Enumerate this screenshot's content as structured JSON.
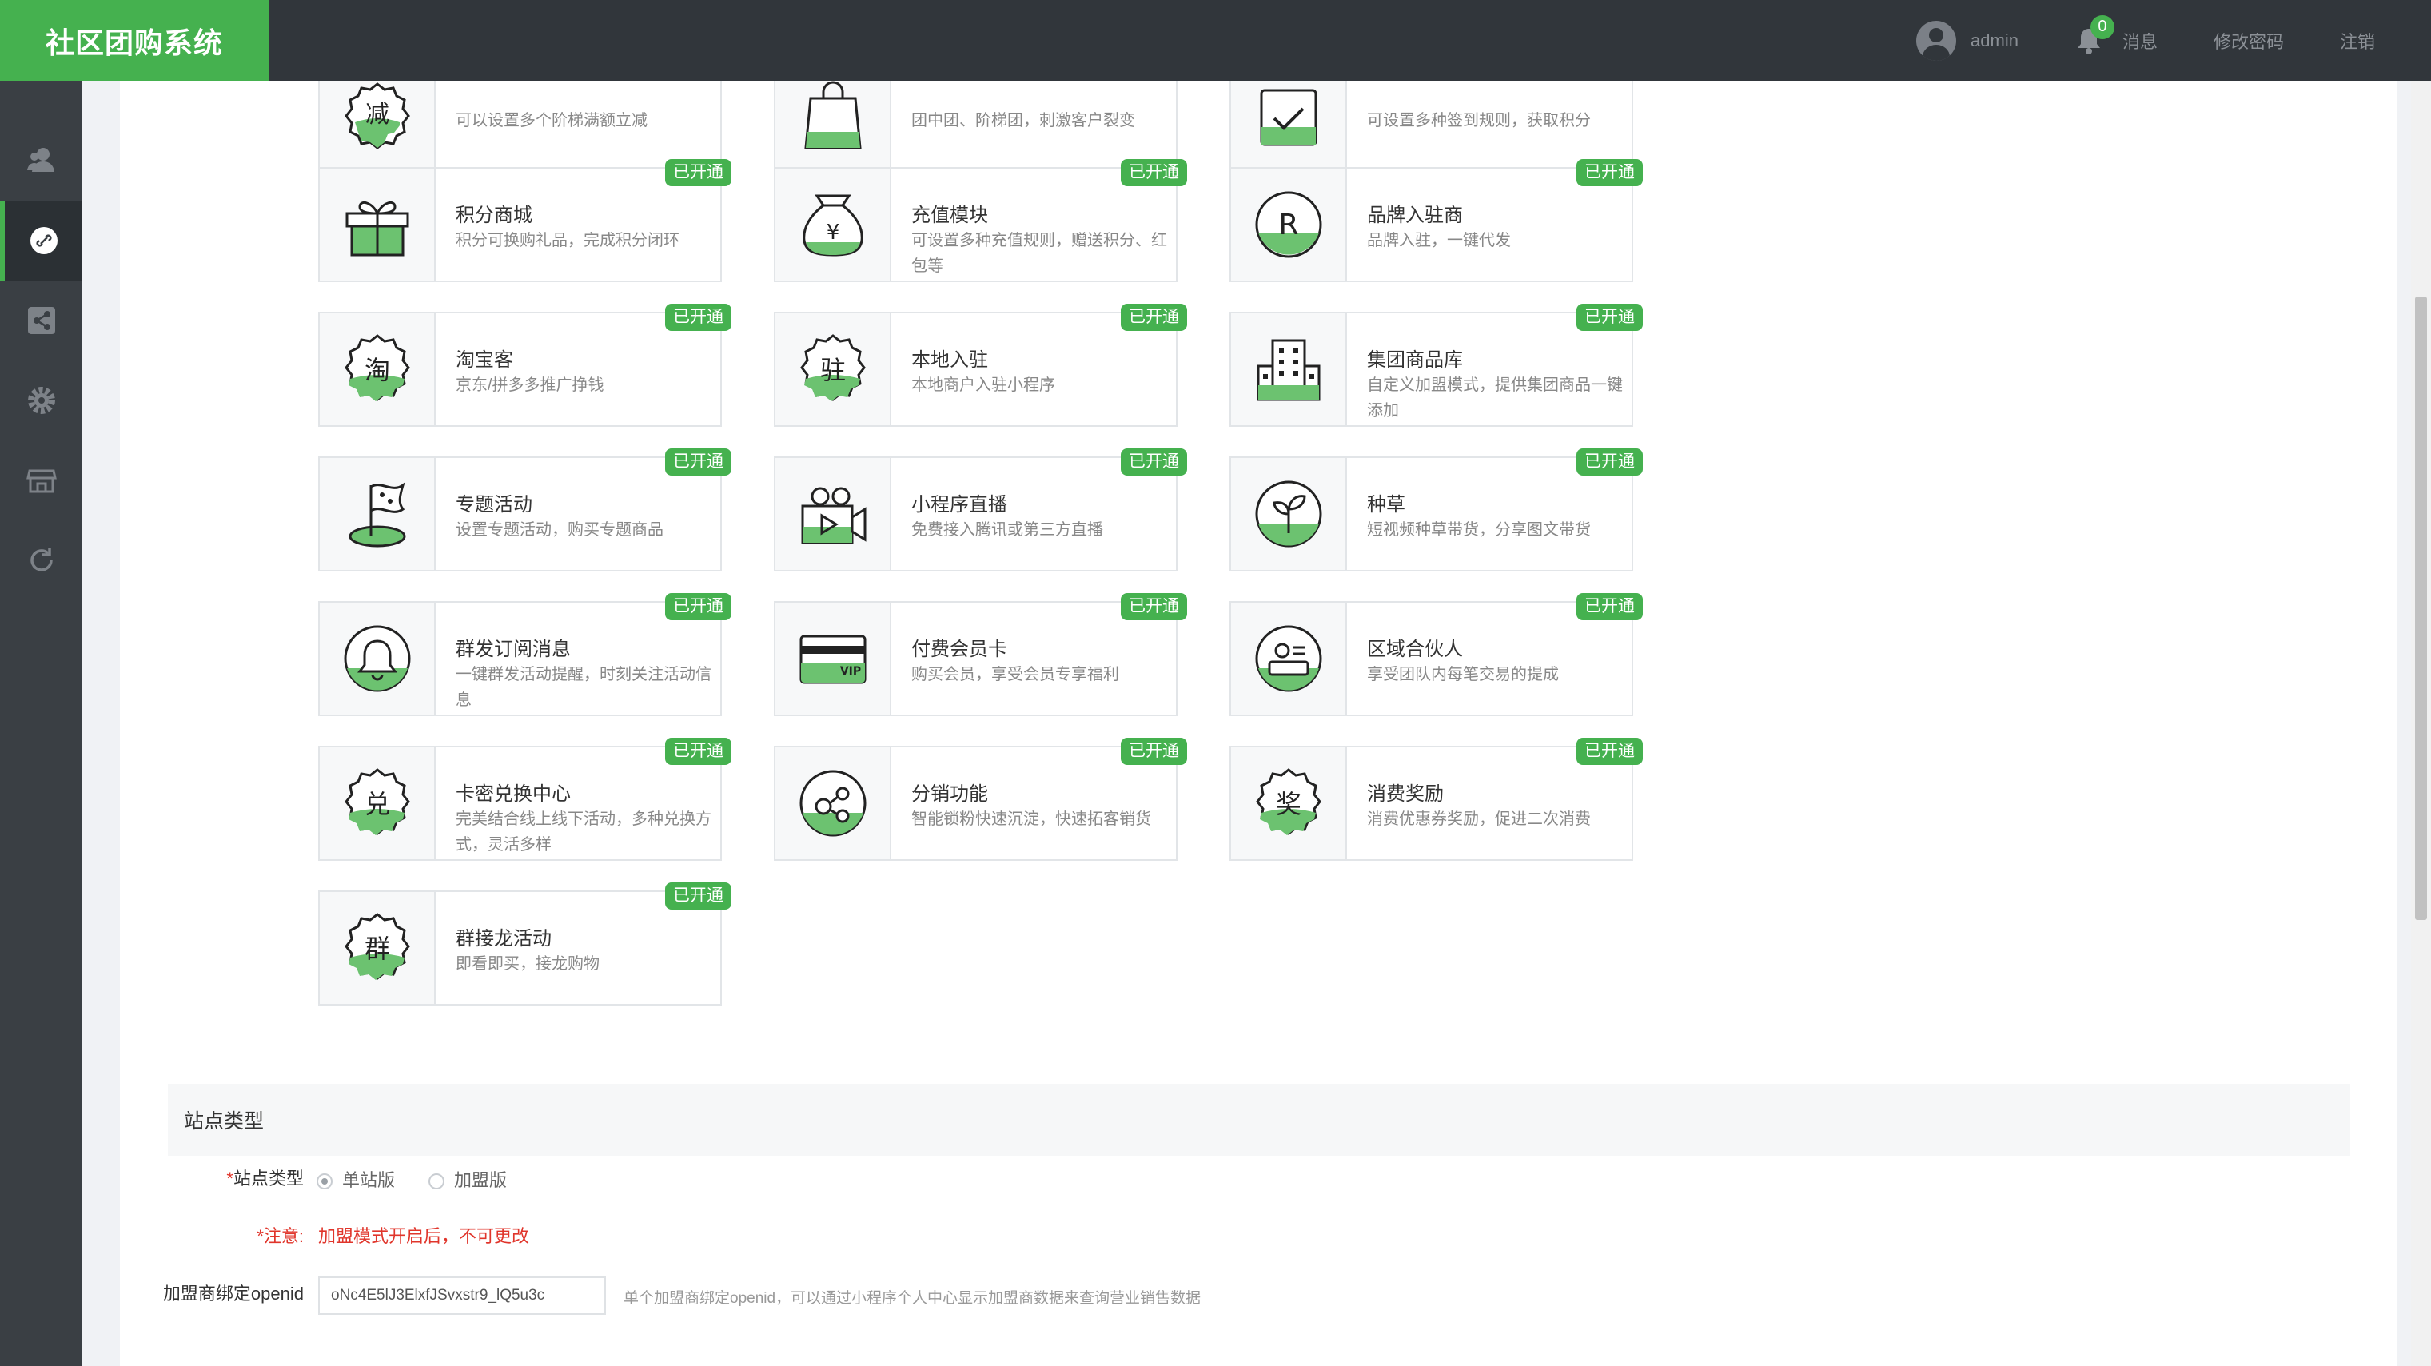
{
  "app": {
    "title": "社区团购系统"
  },
  "header": {
    "username": "admin",
    "notification_count": "0",
    "messages_label": "消息",
    "change_password_label": "修改密码",
    "logout_label": "注销"
  },
  "sidebar": {
    "items": [
      {
        "icon": "user-icon"
      },
      {
        "icon": "link-icon"
      },
      {
        "icon": "share-icon"
      },
      {
        "icon": "gear-icon"
      },
      {
        "icon": "store-icon"
      },
      {
        "icon": "refresh-icon"
      }
    ]
  },
  "colors": {
    "accent": "#45b14f",
    "topbar": "#31363b",
    "sidebar": "#3a3f44",
    "required": "#e0352b"
  },
  "modules": [
    {
      "title": "",
      "desc": "可以设置多个阶梯满额立减",
      "tag": "",
      "icon": "discount-icon"
    },
    {
      "title": "",
      "desc": "团中团、阶梯团，刺激客户裂变",
      "tag": "",
      "icon": "group-bag-icon"
    },
    {
      "title": "",
      "desc": "可设置多种签到规则，获取积分",
      "tag": "",
      "icon": "checkin-icon"
    },
    {
      "title": "积分商城",
      "desc": "积分可换购礼品，完成积分闭环",
      "tag": "已开通",
      "icon": "gift-icon"
    },
    {
      "title": "充值模块",
      "desc": "可设置多种充值规则，赠送积分、红包等",
      "tag": "已开通",
      "icon": "money-bag-icon"
    },
    {
      "title": "品牌入驻商",
      "desc": "品牌入驻，一键代发",
      "tag": "已开通",
      "icon": "registered-brand-icon"
    },
    {
      "title": "淘宝客",
      "desc": "京东/拼多多推广挣钱",
      "tag": "已开通",
      "icon": "taobao-badge-icon"
    },
    {
      "title": "本地入驻",
      "desc": "本地商户入驻小程序",
      "tag": "已开通",
      "icon": "local-merchant-icon"
    },
    {
      "title": "集团商品库",
      "desc": "自定义加盟模式，提供集团商品一键添加",
      "tag": "已开通",
      "icon": "building-icon"
    },
    {
      "title": "专题活动",
      "desc": "设置专题活动，购买专题商品",
      "tag": "已开通",
      "icon": "flag-icon"
    },
    {
      "title": "小程序直播",
      "desc": "免费接入腾讯或第三方直播",
      "tag": "已开通",
      "icon": "video-camera-icon"
    },
    {
      "title": "种草",
      "desc": "短视频种草带货，分享图文带货",
      "tag": "已开通",
      "icon": "sprout-icon"
    },
    {
      "title": "群发订阅消息",
      "desc": "一键群发活动提醒，时刻关注活动信息",
      "tag": "已开通",
      "icon": "bell-icon"
    },
    {
      "title": "付费会员卡",
      "desc": "购买会员，享受会员专享福利",
      "tag": "已开通",
      "icon": "vip-card-icon"
    },
    {
      "title": "区域合伙人",
      "desc": "享受团队内每笔交易的提成",
      "tag": "已开通",
      "icon": "partner-card-icon"
    },
    {
      "title": "卡密兑换中心",
      "desc": "完美结合线上线下活动，多种兑换方式，灵活多样",
      "tag": "已开通",
      "icon": "exchange-badge-icon"
    },
    {
      "title": "分销功能",
      "desc": "智能锁粉快速沉淀，快速拓客销货",
      "tag": "已开通",
      "icon": "distribution-icon"
    },
    {
      "title": "消费奖励",
      "desc": "消费优惠券奖励，促进二次消费",
      "tag": "已开通",
      "icon": "reward-badge-icon"
    },
    {
      "title": "群接龙活动",
      "desc": "即看即买，接龙购物",
      "tag": "已开通",
      "icon": "group-chain-badge-icon"
    }
  ],
  "icon_glyphs": {
    "discount": "减",
    "taobao": "淘",
    "local": "驻",
    "exchange": "兑",
    "reward": "奖",
    "group": "群",
    "money": "¥",
    "brand": "R",
    "vip": "VIP"
  },
  "site": {
    "section_title": "站点类型",
    "type_label": "站点类型",
    "options": [
      "单站版",
      "加盟版"
    ],
    "selected": "单站版",
    "notice_label": "注意:",
    "notice_text": "加盟模式开启后，不可更改",
    "openid_label": "加盟商绑定openid",
    "openid_value": "oNc4E5lJ3ElxfJSvxstr9_lQ5u3c",
    "openid_hint": "单个加盟商绑定openid，可以通过小程序个人中心显示加盟商数据来查询营业销售数据"
  }
}
